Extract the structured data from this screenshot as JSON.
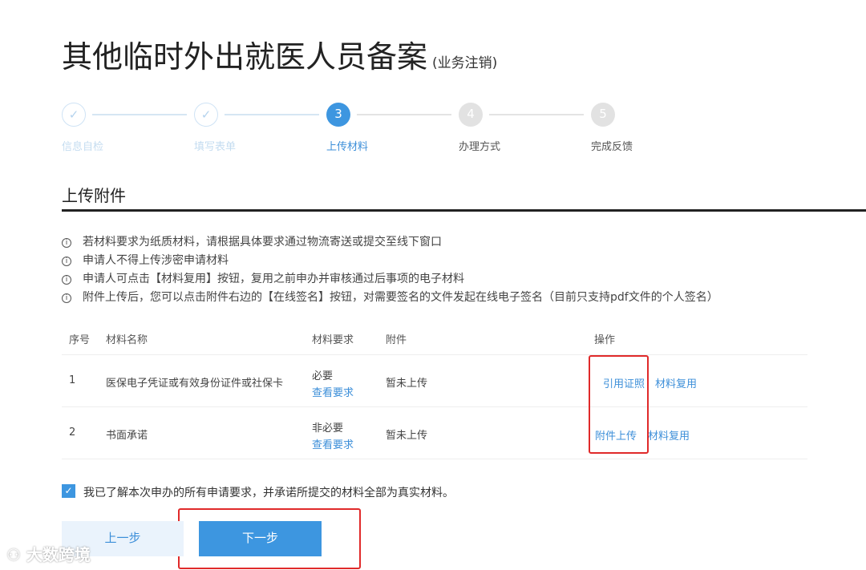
{
  "title": "其他临时外出就医人员备案",
  "subtitle": "(业务注销)",
  "steps": [
    {
      "num": "1",
      "label": "信息自检",
      "state": "done"
    },
    {
      "num": "2",
      "label": "填写表单",
      "state": "done"
    },
    {
      "num": "3",
      "label": "上传材料",
      "state": "current"
    },
    {
      "num": "4",
      "label": "办理方式",
      "state": "todo"
    },
    {
      "num": "5",
      "label": "完成反馈",
      "state": "todo"
    }
  ],
  "section_title": "上传附件",
  "notes": [
    "若材料要求为纸质材料，请根据具体要求通过物流寄送或提交至线下窗口",
    "申请人不得上传涉密申请材料",
    "申请人可点击【材料复用】按钮，复用之前申办并审核通过后事项的电子材料",
    "附件上传后，您可以点击附件右边的【在线签名】按钮，对需要签名的文件发起在线电子签名（目前只支持pdf文件的个人签名）"
  ],
  "table": {
    "headers": [
      "序号",
      "材料名称",
      "材料要求",
      "附件",
      "操作"
    ],
    "rows": [
      {
        "no": "1",
        "name": "医保电子凭证或有效身份证件或社保卡",
        "req": "必要",
        "req_link": "查看要求",
        "file": "暂未上传",
        "action1": "引用证照",
        "action2": "材料复用"
      },
      {
        "no": "2",
        "name": "书面承诺",
        "req": "非必要",
        "req_link": "查看要求",
        "file": "暂未上传",
        "action1": "附件上传",
        "action2": "材料复用"
      }
    ]
  },
  "agree_text": "我已了解本次申办的所有申请要求，并承诺所提交的材料全部为真实材料。",
  "agree_checked": true,
  "prev_label": "上一步",
  "next_label": "下一步",
  "watermark": "大数跨境",
  "colors": {
    "accent": "#3d96e0",
    "highlight": "#e02a2a"
  }
}
